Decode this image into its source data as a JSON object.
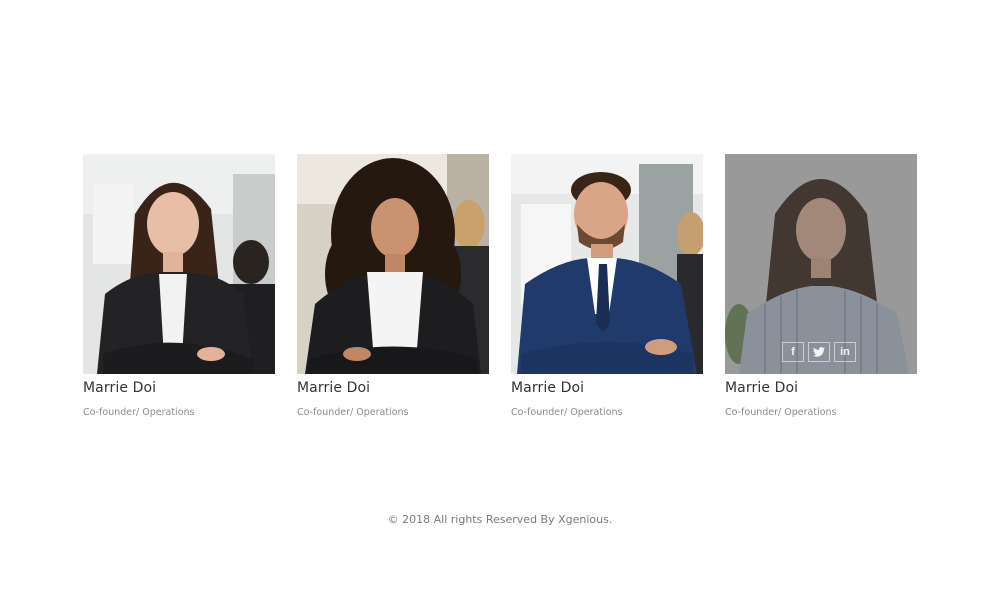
{
  "team": {
    "members": [
      {
        "name": "Marrie Doi",
        "role": "Co-founder/ Operations"
      },
      {
        "name": "Marrie Doi",
        "role": "Co-founder/ Operations"
      },
      {
        "name": "Marrie Doi",
        "role": "Co-founder/ Operations"
      },
      {
        "name": "Marrie Doi",
        "role": "Co-founder/ Operations"
      }
    ],
    "social": {
      "facebook": "f",
      "twitter": "t",
      "linkedin": "in"
    }
  },
  "footer": {
    "copyright": "© 2018 All rights Reserved By Xgenious."
  },
  "colors": {
    "name_text": "#333333",
    "role_text": "#8a8a8a",
    "footer_text": "#7a7a7a"
  }
}
